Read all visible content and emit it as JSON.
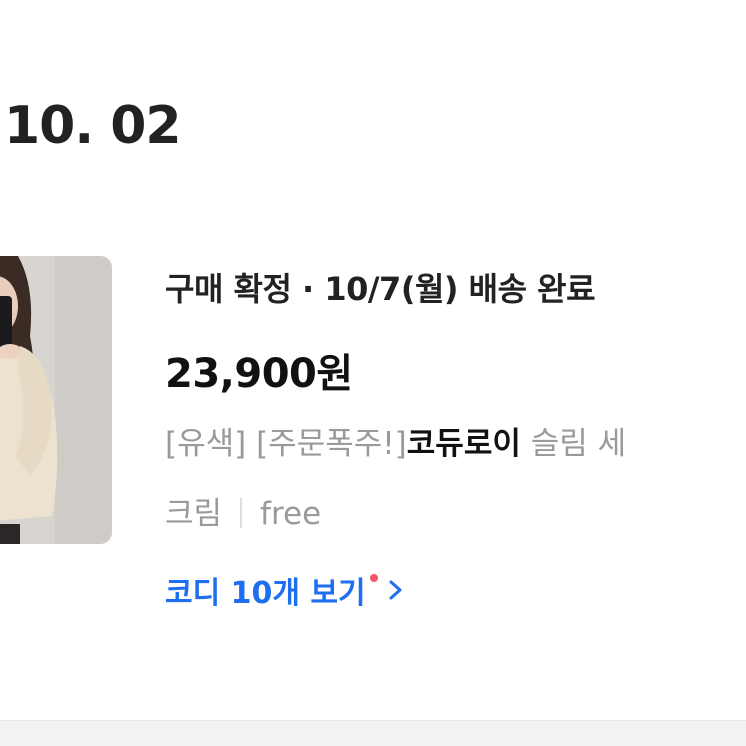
{
  "order": {
    "date": "10. 02",
    "status": "구매 확정 · 10/7(월) 배송 완료",
    "price": "23,900원",
    "product": {
      "prefix": "[유색] [주문폭주!]",
      "brand": "코듀로이",
      "name_tail": " 슬림 세"
    },
    "option": {
      "color": "크림",
      "size": "free"
    },
    "codi_link": {
      "label": "코디 10개 보기",
      "has_new_dot": true,
      "chevron_icon": "chevron-right-icon"
    }
  },
  "colors": {
    "accent_blue": "#1d6ff0",
    "new_dot_red": "#f25563",
    "text_primary": "#222222",
    "text_secondary": "#9a9a9a"
  }
}
